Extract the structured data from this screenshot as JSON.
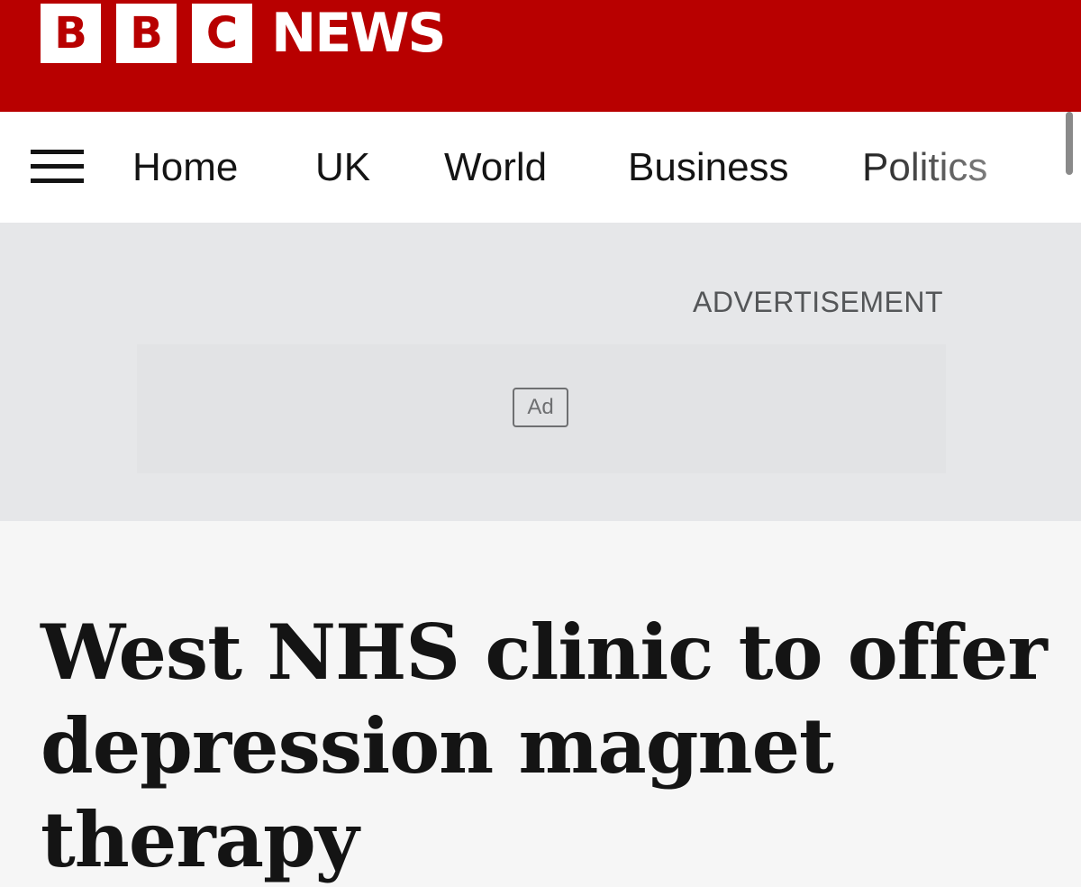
{
  "header": {
    "logo_letters": [
      "B",
      "B",
      "C"
    ],
    "logo_word": "NEWS",
    "brand_color": "#b80000"
  },
  "nav": {
    "menu_icon": "hamburger-menu-icon",
    "items": [
      {
        "label": "Home"
      },
      {
        "label": "UK"
      },
      {
        "label": "World"
      },
      {
        "label": "Business"
      },
      {
        "label": "Politics"
      }
    ]
  },
  "advert": {
    "label": "ADVERTISEMENT",
    "badge": "Ad"
  },
  "article": {
    "headline": "West NHS clinic to offer depression magnet therapy"
  }
}
